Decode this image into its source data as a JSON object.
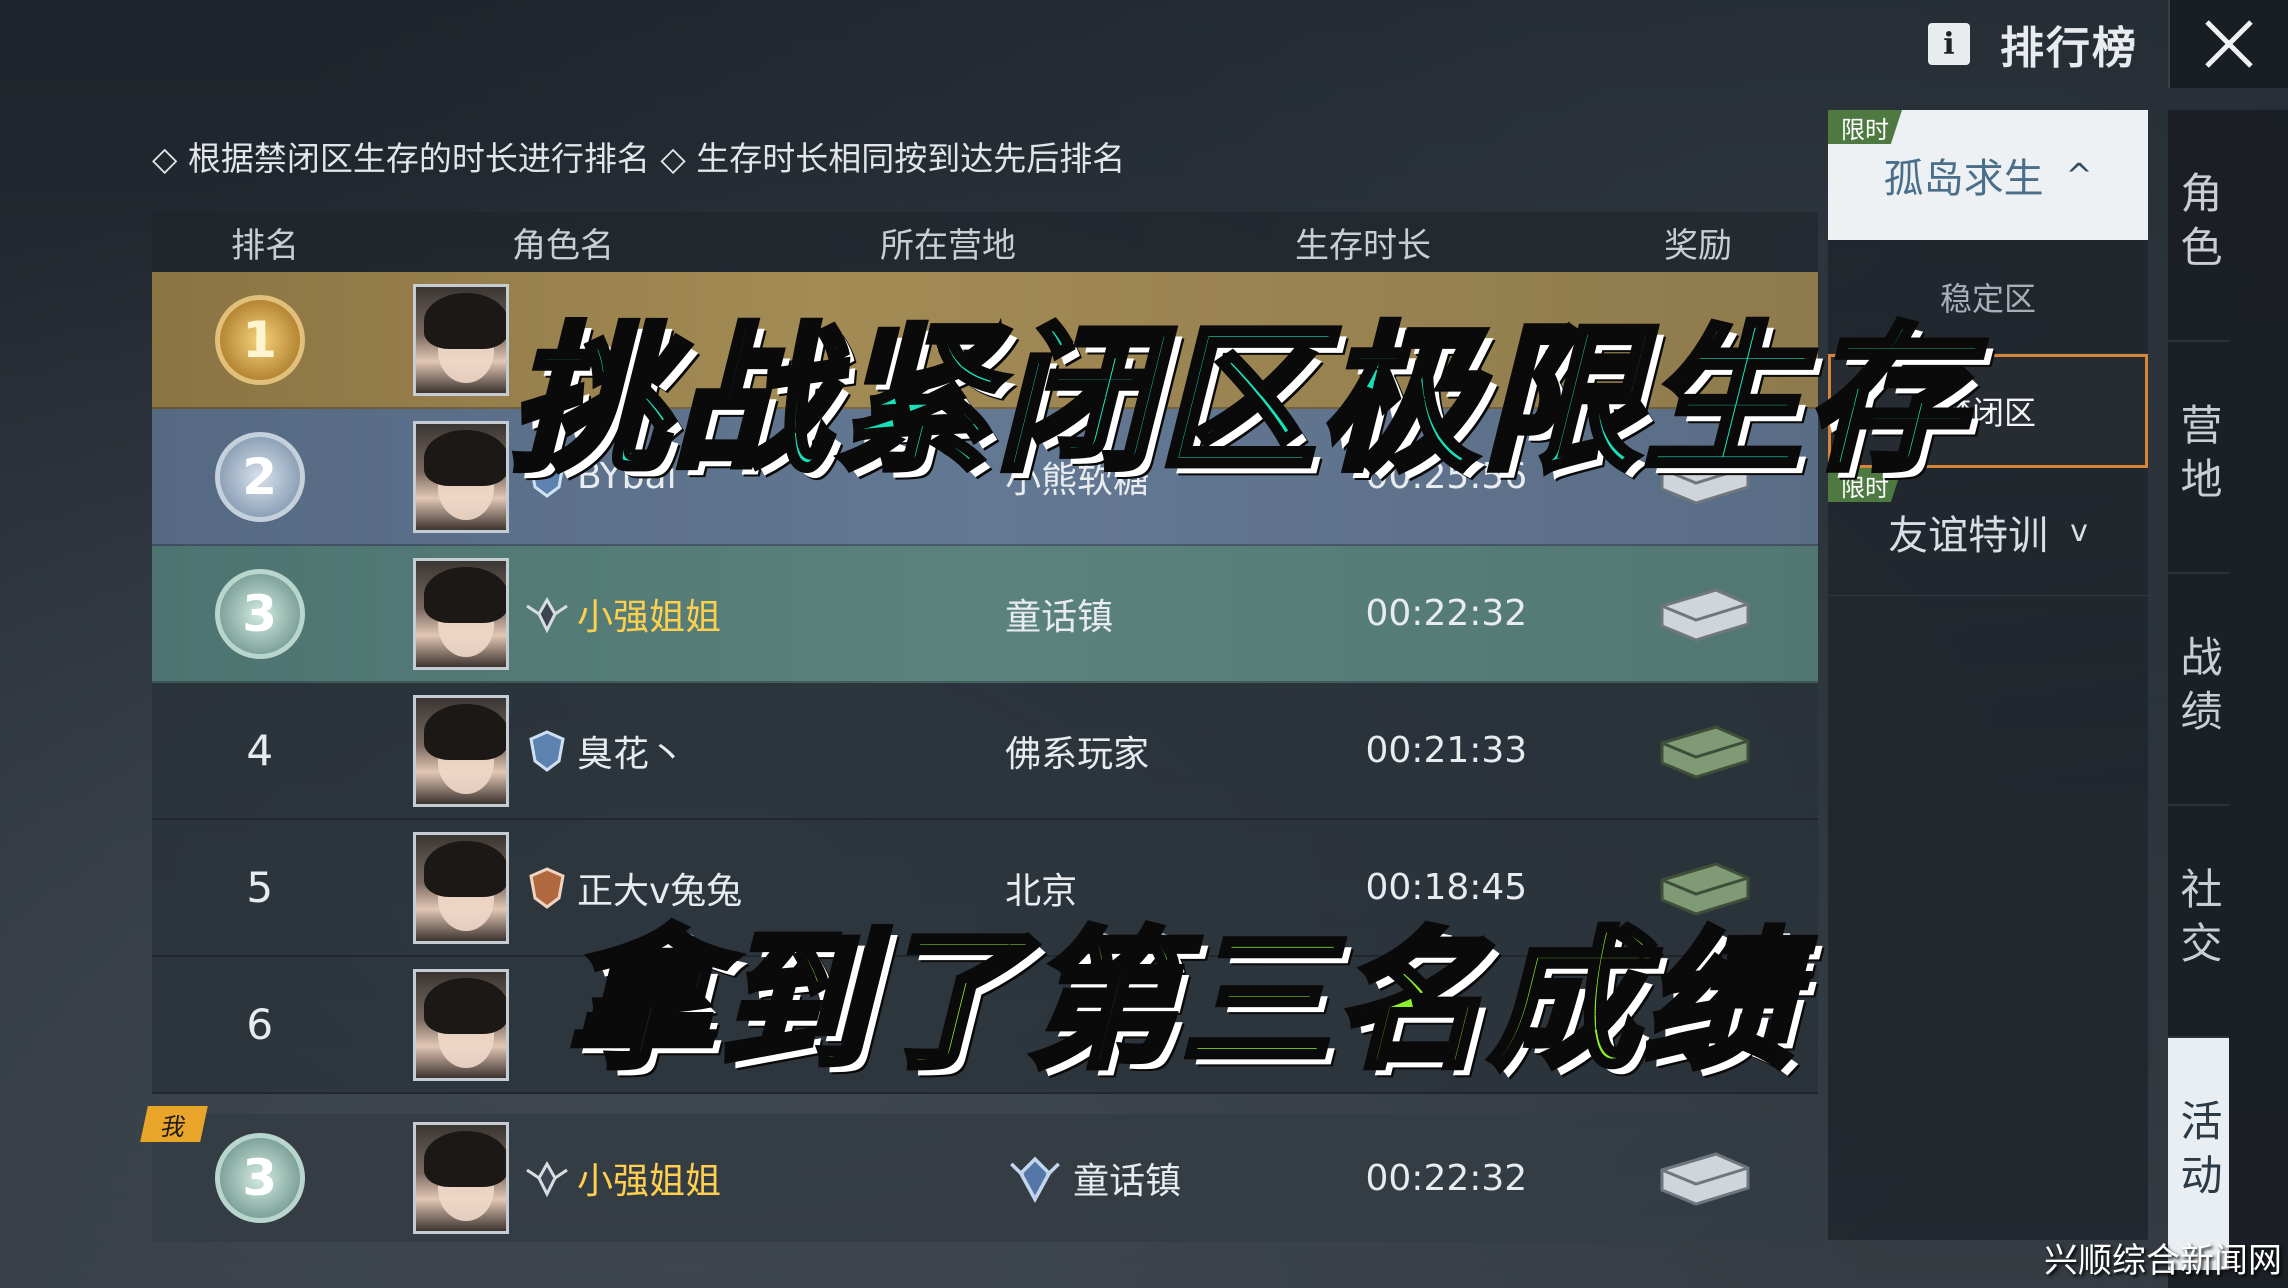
{
  "topbar": {
    "info_label": "i",
    "title": "排行榜",
    "close_icon": "close-icon"
  },
  "hint": "◇ 根据禁闭区生存的时长进行排名 ◇ 生存时长相同按到达先后排名",
  "table": {
    "headers": [
      "排名",
      "角色名",
      "所在营地",
      "生存时长",
      "奖励"
    ],
    "rows": [
      {
        "rank": "1",
        "name": "",
        "camp": "",
        "time": "",
        "tier": "gold"
      },
      {
        "rank": "2",
        "name": "BYbai",
        "camp": "小熊软糖",
        "time": "00:25:56",
        "tier": "silver"
      },
      {
        "rank": "3",
        "name": "小强姐姐",
        "camp": "童话镇",
        "time": "00:22:32",
        "tier": "bronze"
      },
      {
        "rank": "4",
        "name": "臭花丶",
        "camp": "佛系玩家",
        "time": "00:21:33",
        "tier": "plain"
      },
      {
        "rank": "5",
        "name": "正大v兔兔",
        "camp": "北京",
        "time": "00:18:45",
        "tier": "plain"
      },
      {
        "rank": "6",
        "name": "",
        "camp": "",
        "time": "",
        "tier": "plain"
      }
    ],
    "me": {
      "tag": "我",
      "rank": "3",
      "name": "小强姐姐",
      "camp": "童话镇",
      "time": "00:22:32"
    }
  },
  "mode_panel": {
    "limited_label": "限时",
    "mode1": "孤岛求生",
    "mode1_chevron": "^",
    "sub_items": [
      "稳定区",
      "禁闭区"
    ],
    "mode2_limited_label": "限时",
    "mode2": "友谊特训",
    "mode2_chevron": "v"
  },
  "side_tabs": [
    "角色",
    "营地",
    "战绩",
    "社交",
    "活动"
  ],
  "overlays": {
    "top": "挑战紧闭区极限生存",
    "bottom": "拿到了第三名成绩"
  },
  "watermark": "兴顺综合新闻网",
  "colors": {
    "gold_row": "#a38b55",
    "silver_row": "#637893",
    "bronze_row": "#5b827c",
    "me_name": "#ffcf4f",
    "active_border": "#d3853a",
    "overlay_top": "#19e0b8",
    "overlay_bottom": "#8cf02b"
  }
}
